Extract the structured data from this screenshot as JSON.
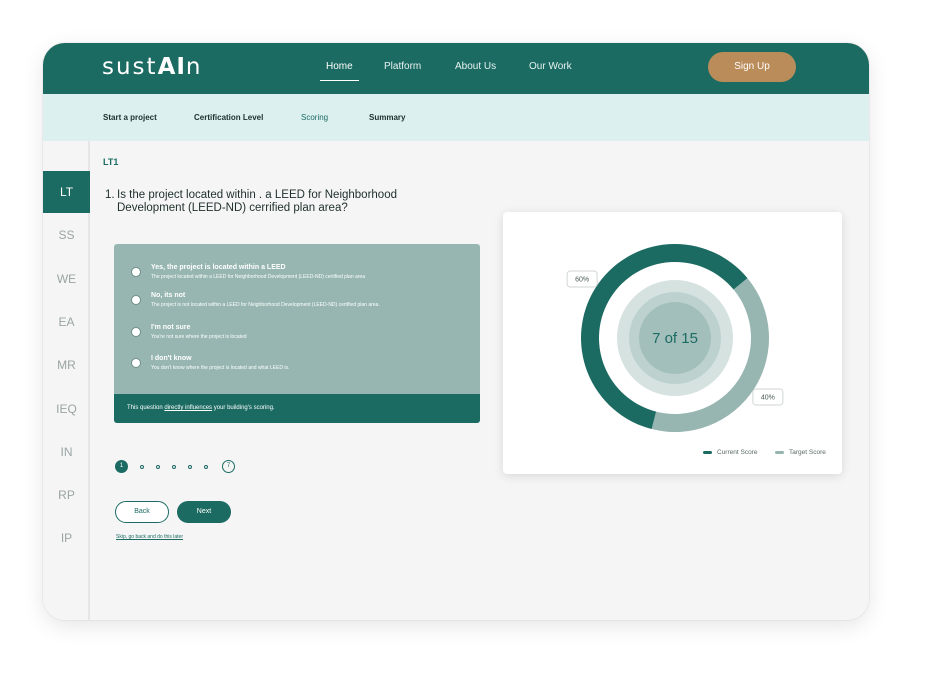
{
  "app": {
    "logo_prefix": "sust",
    "logo_bold": "AI",
    "logo_suffix": "n"
  },
  "nav": {
    "links": [
      {
        "label": "Home",
        "active": true
      },
      {
        "label": "Platform"
      },
      {
        "label": "About Us"
      },
      {
        "label": "Our Work"
      }
    ],
    "signup_label": "Sign Up"
  },
  "steps": [
    {
      "label": "Start a project"
    },
    {
      "label": "Certification Level"
    },
    {
      "label": "Scoring",
      "active": true
    },
    {
      "label": "Summary"
    }
  ],
  "sidebar": {
    "items": [
      {
        "label": "LT",
        "active": true
      },
      {
        "label": "SS"
      },
      {
        "label": "WE"
      },
      {
        "label": "EA"
      },
      {
        "label": "MR"
      },
      {
        "label": "IEQ"
      },
      {
        "label": "IN"
      },
      {
        "label": "RP"
      },
      {
        "label": "IP"
      }
    ]
  },
  "question": {
    "section_code": "LT1",
    "number": "1.",
    "text": "Is the project located within . a LEED for Neighborhood Development (LEED-ND) cerrified plan area?"
  },
  "options": [
    {
      "title": "Yes, the project is located within a LEED",
      "desc": "The project located within  a LEED for Neighborhood Development (LEED-ND) certified plan area"
    },
    {
      "title": "No, its not",
      "desc": "The project is not located within a LEED for Neighborhood Development (LEED-ND) certified plan area."
    },
    {
      "title": "I'm not sure",
      "desc": "You're not sure where the project is located"
    },
    {
      "title": "I don't know",
      "desc": "You don't know where the project is located and what LEED is."
    }
  ],
  "options_footer": {
    "prefix": "This question ",
    "link": "directly influences",
    "suffix": " your building's scoring."
  },
  "pager": {
    "current": "1",
    "last": "7"
  },
  "buttons": {
    "back": "Back",
    "next": "Next",
    "skip": "Skip, go back and do this later"
  },
  "colors": {
    "primary": "#1c6b63",
    "secondary": "#97b6b1",
    "accent": "#b98c5a",
    "steps_bg": "#dcf0ef"
  },
  "chart_data": {
    "type": "pie",
    "center_label": "7 of 15",
    "series": [
      {
        "name": "Current Score",
        "value": 60,
        "label": "60%",
        "color": "#1c6b63"
      },
      {
        "name": "Target Score",
        "value": 40,
        "label": "40%",
        "color": "#97b6b1"
      }
    ],
    "legend_position": "bottom-right"
  }
}
